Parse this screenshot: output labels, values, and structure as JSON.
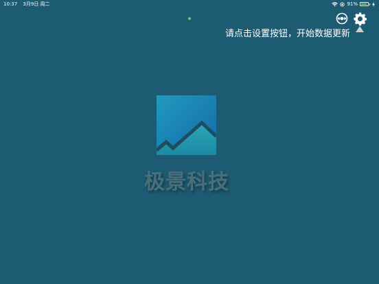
{
  "status_bar": {
    "time": "10:37",
    "date": "3月9日 周二",
    "battery_percent": "91%",
    "battery_level": 0.91,
    "wifi_icon": "wifi-icon",
    "lock_icon": "orientation-lock-icon"
  },
  "toolbar": {
    "sync_icon": "sync-icon",
    "settings_icon": "gear-icon"
  },
  "hint": {
    "text": "请点击设置按钮，开始数据更新"
  },
  "brand": {
    "name": "极景科技",
    "logo_icon": "mountain-logo-icon"
  },
  "colors": {
    "background": "#1d5b72",
    "battery": "#4cd964",
    "brand_text": "#4a6f7c"
  }
}
